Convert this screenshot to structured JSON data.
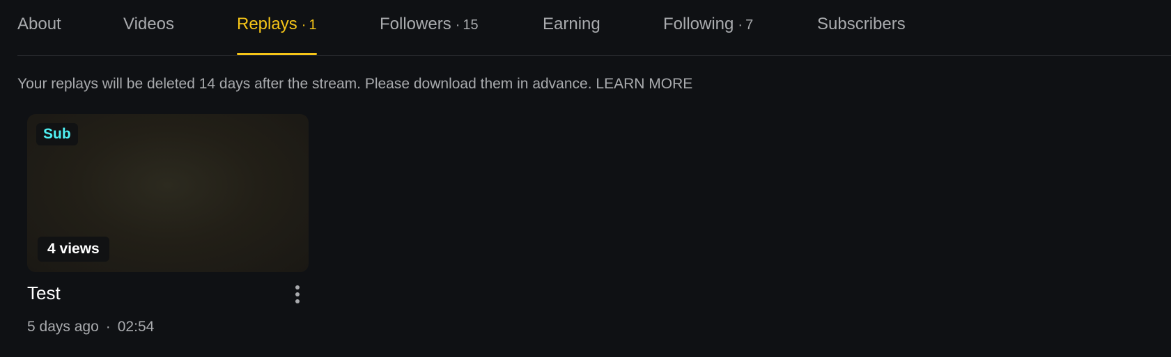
{
  "tabs": [
    {
      "label": "About",
      "count": ""
    },
    {
      "label": "Videos",
      "count": ""
    },
    {
      "label": "Replays",
      "count": "1"
    },
    {
      "label": "Followers",
      "count": "15"
    },
    {
      "label": "Earning",
      "count": ""
    },
    {
      "label": "Following",
      "count": "7"
    },
    {
      "label": "Subscribers",
      "count": ""
    }
  ],
  "active_tab": "Replays",
  "notice": {
    "text": "Your replays will be deleted 14 days after the stream. Please download them in advance.",
    "link": "LEARN MORE"
  },
  "replays": [
    {
      "badge": "Sub",
      "views": "4 views",
      "title": "Test",
      "age": "5 days ago",
      "separator": "·",
      "duration": "02:54"
    }
  ],
  "colors": {
    "background": "#0f1114",
    "accent": "#f5c518",
    "sub_badge": "#4ff0f2",
    "muted_text": "#a9abae"
  }
}
